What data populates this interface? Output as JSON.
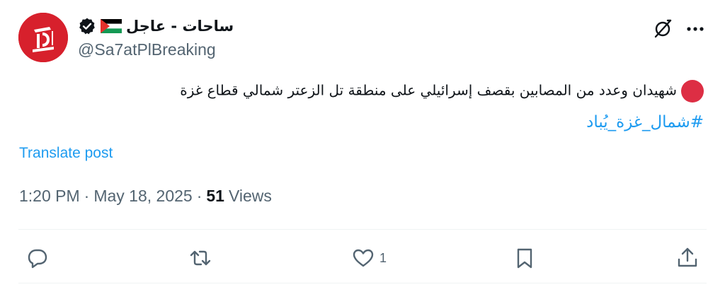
{
  "author": {
    "display_name": "ساحات - عاجل",
    "handle": "@Sa7atPlBreaking",
    "verified_icon": "verified-badge-icon",
    "flag_icon": "palestine-flag-icon",
    "avatar_icon": "sahat-logo-icon"
  },
  "header_actions": {
    "grok_icon": "grok-icon",
    "more_icon": "more-options-icon"
  },
  "tweet": {
    "emoji": "red-circle-icon",
    "text": "شهيدان وعدد من المصابين بقصف إسرائيلي على منطقة تل الزعتر شمالي قطاع غزة",
    "hashtag": "#شمال_غزة_يُباد",
    "translate_label": "Translate post"
  },
  "meta": {
    "time": "1:20 PM",
    "date": "May 18, 2025",
    "views_count": "51",
    "views_label": "Views"
  },
  "action_bar": {
    "reply_icon": "reply-icon",
    "retweet_icon": "retweet-icon",
    "like_icon": "like-heart-icon",
    "like_count": "1",
    "bookmark_icon": "bookmark-icon",
    "share_icon": "share-icon"
  },
  "colors": {
    "accent": "#1d9bf0",
    "secondary_text": "#536471",
    "avatar_red": "#d7202c",
    "emoji_red": "#dd2e44"
  }
}
